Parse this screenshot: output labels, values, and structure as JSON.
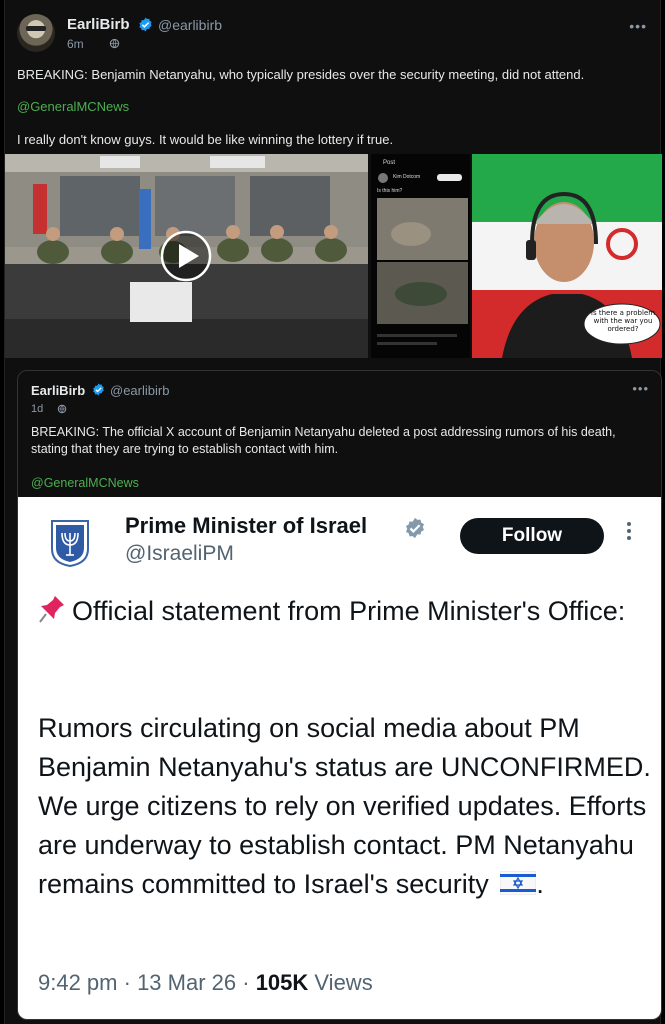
{
  "post": {
    "author_name": "EarliBirb",
    "handle": "@earlibirb",
    "time": "6m",
    "text": "BREAKING: Benjamin Netanyahu, who typically presides over the security meeting, did not attend.",
    "mention": "@GeneralMCNews",
    "text2": "I really don't know guys. It would be like winning the lottery if true.",
    "more": "•••"
  },
  "media": {
    "image2_header": "Post",
    "image2_user": "Kim Dotcom",
    "image2_question": "Is this him?",
    "image3_bubble": "Is there a problem with the war you ordered?"
  },
  "quote": {
    "author_name": "EarliBirb",
    "handle": "@earlibirb",
    "time": "1d",
    "text": "BREAKING: The official X account of Benjamin Netanyahu deleted a post addressing rumors of his death, stating that they are trying to establish contact with him.",
    "mention": "@GeneralMCNews",
    "more": "•••"
  },
  "embedded": {
    "name": "Prime Minister of Israel",
    "handle": "@IsraeliPM",
    "follow_label": "Follow",
    "statement_title": "Official statement from Prime Minister's Office:",
    "statement_body": "Rumors circulating on social media about PM Benjamin Netanyahu's status are UNCONFIRMED. We urge citizens to rely on verified updates. Efforts are underway to establish contact. PM Netanyahu remains committed to Israel's security",
    "statement_end": ".",
    "time": "9:42 pm",
    "date": "13 Mar 26",
    "views_count": "105K",
    "views_label": "Views"
  },
  "colors": {
    "background": "#0f0f10",
    "text": "#e7e9ea",
    "muted": "#8b98a5",
    "mention_green": "#4caf50",
    "verified_blue": "#1d9bf0",
    "follow_bg": "#0f1419"
  }
}
